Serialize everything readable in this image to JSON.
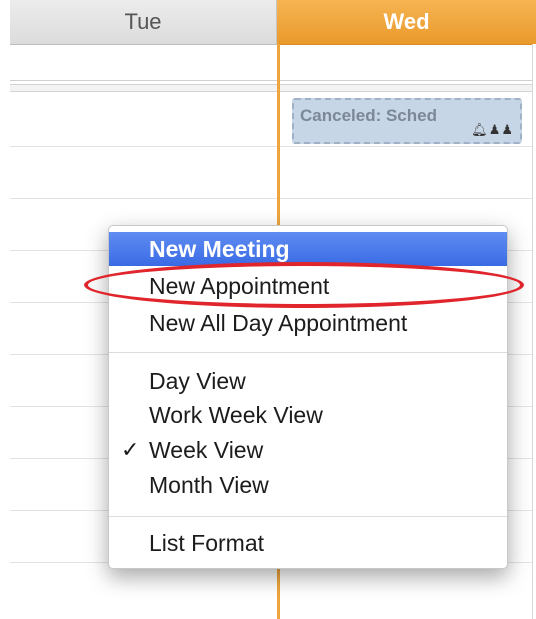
{
  "calendar": {
    "days": [
      "Tue",
      "Wed"
    ],
    "today_color": "#eea63c"
  },
  "appointment": {
    "title": "Canceled: Sched",
    "icons": [
      "bell-icon",
      "attendees-icon"
    ]
  },
  "context_menu": {
    "items": [
      {
        "label": "New Meeting",
        "highlighted": true
      },
      {
        "label": "New Appointment",
        "circled": true
      },
      {
        "label": "New All Day Appointment"
      },
      {
        "label": "Day View"
      },
      {
        "label": "Work Week View"
      },
      {
        "label": "Week View",
        "checked": true,
        "check_glyph": "✓"
      },
      {
        "label": "Month View"
      },
      {
        "label": "List Format"
      }
    ],
    "highlight_color": "#3a6ae4",
    "annotation_color": "#e0262c"
  }
}
